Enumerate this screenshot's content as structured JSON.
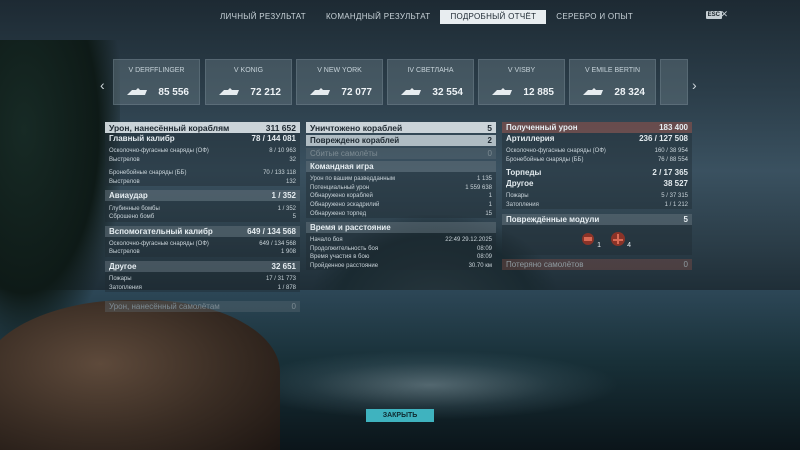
{
  "tabs": [
    "ЛИЧНЫЙ РЕЗУЛЬТАТ",
    "КОМАНДНЫЙ РЕЗУЛЬТАТ",
    "ПОДРОБНЫЙ ОТЧЁТ",
    "СЕРЕБРО И ОПЫТ"
  ],
  "esc": "ESC",
  "ships": [
    {
      "name": "V DERFFLINGER",
      "sub": "",
      "damage": "85 556"
    },
    {
      "name": "V KONIG",
      "sub": "",
      "damage": "72 212"
    },
    {
      "name": "V NEW YORK",
      "sub": "",
      "damage": "72 077"
    },
    {
      "name": "IV СВЕТЛАНА",
      "sub": "",
      "damage": "32 554"
    },
    {
      "name": "V VISBY",
      "sub": "",
      "damage": "12 885"
    },
    {
      "name": "V EMILE BERTIN",
      "sub": "",
      "damage": "28 324"
    }
  ],
  "left": {
    "damage_title": "Урон, нанесённый кораблям",
    "damage_value": "311 652",
    "main_caliber": "Главный калибр",
    "main_caliber_value": "78 / 144 081",
    "he_shells": "Осколочно-фугасные снаряды (ОФ)",
    "he_shells_value": "8 / 10 963",
    "shots1": "Выстрелов",
    "shots1_value": "32",
    "ap_shells": "Бронебойные снаряды (ББ)",
    "ap_shells_value": "70 / 133 118",
    "shots2": "Выстрелов",
    "shots2_value": "132",
    "airstrike": "Авиаудар",
    "airstrike_value": "1 / 352",
    "depth": "Глубинные бомбы",
    "depth_value": "1 / 352",
    "dropped": "Сброшено бомб",
    "dropped_value": "5",
    "secondary": "Вспомогательный калибр",
    "secondary_value": "649 / 134 568",
    "he2": "Осколочно-фугасные снаряды (ОФ)",
    "he2_value": "649 / 134 568",
    "shots3": "Выстрелов",
    "shots3_value": "1 908",
    "other": "Другое",
    "other_value": "32 651",
    "fires": "Пожары",
    "fires_value": "17 / 31 773",
    "floods": "Затопления",
    "floods_value": "1 / 878",
    "planes_damage": "Урон, нанесённый самолётам",
    "planes_damage_value": "0"
  },
  "mid": {
    "destroyed": "Уничтожено кораблей",
    "destroyed_value": "5",
    "damaged": "Повреждено кораблей",
    "damaged_value": "2",
    "planes_down": "Сбитые самолёты",
    "planes_down_value": "0",
    "team": "Командная игра",
    "spot_dmg": "Урон по вашим разведданным",
    "spot_dmg_value": "1 135",
    "potential": "Потенциальный урон",
    "potential_value": "1 559 638",
    "spotted_ships": "Обнаружено кораблей",
    "spotted_ships_value": "1",
    "spotted_squads": "Обнаружено эскадрилий",
    "spotted_squads_value": "1",
    "spotted_torps": "Обнаружено торпед",
    "spotted_torps_value": "15",
    "time": "Время и расстояние",
    "start": "Начало боя",
    "start_value": "22:49  29.12.2025",
    "duration": "Продолжительность боя",
    "duration_value": "08:09",
    "participation": "Время участия в бою",
    "participation_value": "08:09",
    "distance": "Пройденное расстояние",
    "distance_value": "30.70 км"
  },
  "right": {
    "received": "Полученный урон",
    "received_value": "183 400",
    "artillery": "Артиллерия",
    "artillery_value": "236 / 127 508",
    "he": "Осколочно-фугасные снаряды (ОФ)",
    "he_value": "160 / 38 954",
    "ap": "Бронебойные снаряды (ББ)",
    "ap_value": "76 / 88 554",
    "torps": "Торпеды",
    "torps_value": "2 / 17 365",
    "other": "Другое",
    "other_value": "38 527",
    "fires": "Пожары",
    "fires_value": "5 / 37 315",
    "floods": "Затопления",
    "floods_value": "1 / 1 212",
    "modules": "Повреждённые модули",
    "modules_value": "5",
    "mod1": "1",
    "mod2": "4",
    "lost_planes": "Потеряно самолётов",
    "lost_planes_value": "0"
  },
  "close": "ЗАКРЫТЬ"
}
